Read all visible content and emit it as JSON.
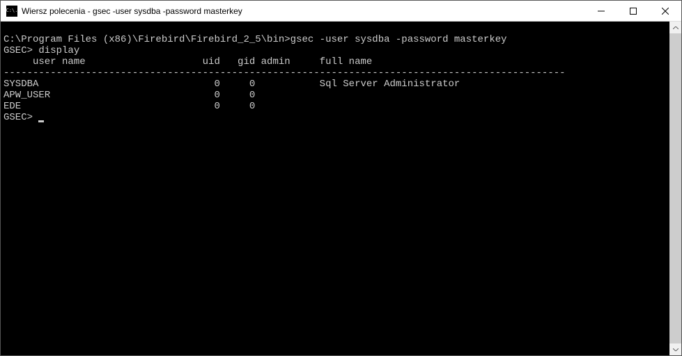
{
  "titlebar": {
    "icon_label": "C:\\.",
    "title": "Wiersz polecenia - gsec  -user sysdba -password masterkey"
  },
  "terminal": {
    "line0": "",
    "line1": "C:\\Program Files (x86)\\Firebird\\Firebird_2_5\\bin>gsec -user sysdba -password masterkey",
    "line2": "GSEC> display",
    "header": "     user name                    uid   gid admin     full name",
    "divider": "------------------------------------------------------------------------------------------------",
    "rows": [
      "SYSDBA                              0     0           Sql Server Administrator",
      "APW_USER                            0     0",
      "EDE                                 0     0"
    ],
    "prompt": "GSEC> "
  }
}
